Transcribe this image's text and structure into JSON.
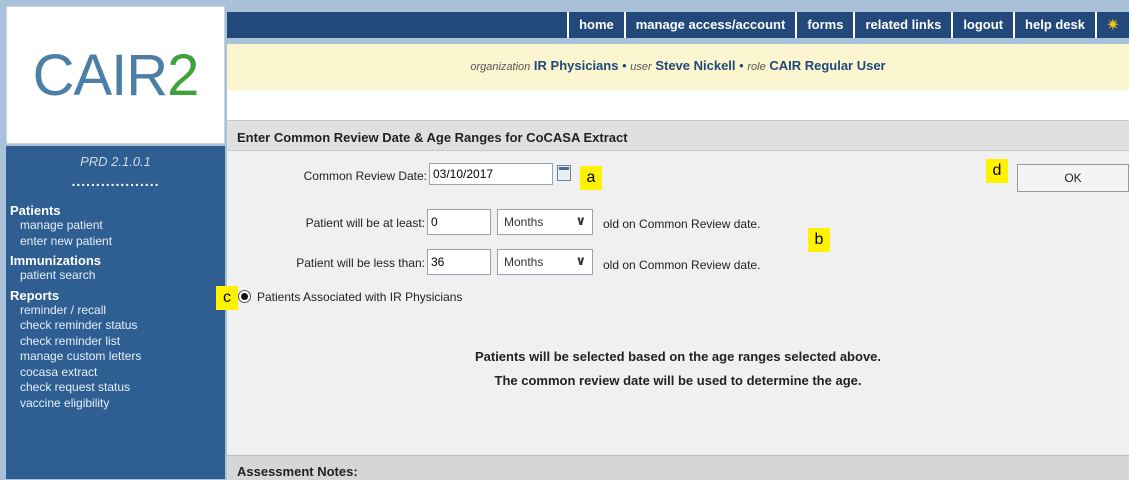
{
  "logo": {
    "main": "CAIR",
    "suffix": "2"
  },
  "sidebar": {
    "version": "PRD 2.1.0.1",
    "dots": "..................",
    "sections": [
      {
        "title": "Patients",
        "links": [
          "manage patient",
          "enter new patient"
        ]
      },
      {
        "title": "Immunizations",
        "links": [
          "patient search"
        ]
      },
      {
        "title": "Reports",
        "links": [
          "reminder / recall",
          "check reminder status",
          "check reminder list",
          "manage custom letters",
          "cocasa extract",
          "check request status",
          "vaccine eligibility"
        ]
      }
    ]
  },
  "topnav": {
    "items": [
      "home",
      "manage access/account",
      "forms",
      "related links",
      "logout",
      "help desk"
    ],
    "bulb_icon": "lightbulb-icon"
  },
  "userbar": {
    "org_label": "organization",
    "org_value": "IR Physicians",
    "user_label": "user",
    "user_value": "Steve Nickell",
    "role_label": "role",
    "role_value": "CAIR Regular User",
    "separator": "•"
  },
  "form": {
    "heading": "Enter Common Review Date & Age Ranges for CoCASA Extract",
    "review_date_label": "Common Review Date:",
    "review_date_value": "03/10/2017",
    "at_least_label": "Patient will be at least:",
    "at_least_value": "0",
    "at_least_unit": "Months",
    "less_than_label": "Patient will be less than:",
    "less_than_value": "36",
    "less_than_unit": "Months",
    "suffix_text": "old on Common Review date.",
    "radio_label": "Patients Associated with IR Physicians",
    "info_line_1": "Patients will be selected based on the age ranges selected above.",
    "info_line_2": "The common review date will be used to determine the age.",
    "ok_label": "OK",
    "notes_heading": "Assessment Notes:"
  },
  "badges": {
    "a": "a",
    "b": "b",
    "c": "c",
    "d": "d"
  },
  "colors": {
    "nav_bg": "#23497a",
    "sidebar_bg": "#2f5f92",
    "userbar_bg": "#fbf6cf",
    "badge_bg": "#fff200"
  }
}
